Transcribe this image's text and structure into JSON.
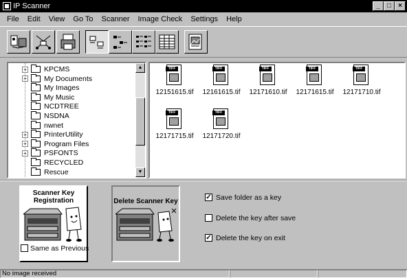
{
  "window": {
    "title": "IP Scanner",
    "controls": [
      "_",
      "□",
      "×"
    ]
  },
  "menu": [
    {
      "label": "File"
    },
    {
      "label": "Edit"
    },
    {
      "label": "View"
    },
    {
      "label": "Go To"
    },
    {
      "label": "Scanner"
    },
    {
      "label": "Image Check"
    },
    {
      "label": "Settings"
    },
    {
      "label": "Help"
    }
  ],
  "toolbar": {
    "buttons": [
      "scan-to-folder-icon",
      "network-icon",
      "printer-icon",
      "large-icons-view-icon",
      "small-icons-view-icon",
      "list-view-icon",
      "details-view-icon",
      "image-preview-icon"
    ]
  },
  "tree": {
    "items": [
      {
        "label": "KPCMS",
        "expandable": true
      },
      {
        "label": "My Documents",
        "expandable": true
      },
      {
        "label": "My Images",
        "expandable": false
      },
      {
        "label": "My Music",
        "expandable": false
      },
      {
        "label": "NCDTREE",
        "expandable": false
      },
      {
        "label": "NSDNA",
        "expandable": false
      },
      {
        "label": "nwnet",
        "expandable": false
      },
      {
        "label": "PrinterUtility",
        "expandable": true
      },
      {
        "label": "Program Files",
        "expandable": true
      },
      {
        "label": "PSFONTS",
        "expandable": true
      },
      {
        "label": "RECYCLED",
        "expandable": false
      },
      {
        "label": "Rescue",
        "expandable": false
      }
    ]
  },
  "files": [
    {
      "name": "12151615.tif",
      "tag": "TIFF"
    },
    {
      "name": "12161615.tif",
      "tag": "TIFF"
    },
    {
      "name": "12171610.tif",
      "tag": "TIFF"
    },
    {
      "name": "12171615.tif",
      "tag": "TIFF"
    },
    {
      "name": "12171710.tif",
      "tag": "TIFF"
    },
    {
      "name": "12171715.tif",
      "tag": "TIFF"
    },
    {
      "name": "12171720.tif",
      "tag": "TIFF"
    }
  ],
  "scanner_key": {
    "register_label": "Scanner Key Registration",
    "delete_label": "Delete Scanner Key",
    "same_as_previous": "Same as Previous",
    "same_as_previous_checked": false
  },
  "options": [
    {
      "label": "Save folder as a key",
      "checked": true
    },
    {
      "label": "Delete the key after save",
      "checked": false
    },
    {
      "label": "Delete the key on exit",
      "checked": true
    }
  ],
  "status": {
    "message": "No image received"
  }
}
